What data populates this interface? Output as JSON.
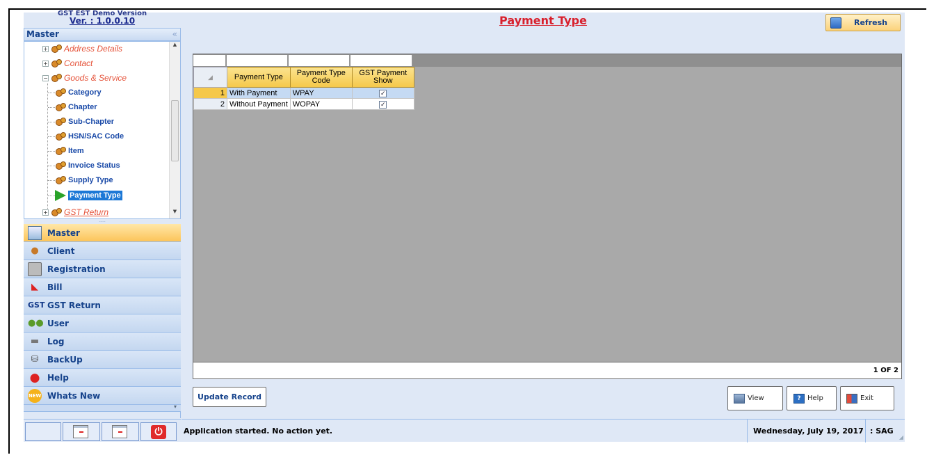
{
  "app": {
    "version_top": "GST EST Demo Version",
    "version": "Ver. : 1.0.0.10"
  },
  "sidebar": {
    "header": "Master",
    "collapse_glyph": "«",
    "tree": {
      "address_details": "Address Details",
      "contact": "Contact",
      "goods_service": "Goods & Service",
      "category": "Category",
      "chapter": "Chapter",
      "sub_chapter": "Sub-Chapter",
      "hsn_sac_code": "HSN/SAC Code",
      "item": "Item",
      "invoice_status": "Invoice Status",
      "supply_type": "Supply Type",
      "payment_type": "Payment Type",
      "gst_return": "GST Return"
    },
    "splitter_glyph": ".....",
    "nav": [
      {
        "label": "Master",
        "icon": "master-icon"
      },
      {
        "label": "Client",
        "icon": "client-icon"
      },
      {
        "label": "Registration",
        "icon": "registration-icon"
      },
      {
        "label": "Bill",
        "icon": "bill-icon"
      },
      {
        "label": "GST Return",
        "icon": "gst-icon",
        "icon_text": "GST"
      },
      {
        "label": "User",
        "icon": "user-icon"
      },
      {
        "label": "Log",
        "icon": "log-icon"
      },
      {
        "label": "BackUp",
        "icon": "backup-icon"
      },
      {
        "label": "Help",
        "icon": "help-icon"
      },
      {
        "label": "Whats New",
        "icon": "new-icon",
        "icon_text": "NEW"
      }
    ]
  },
  "main": {
    "title": "Payment Type",
    "refresh_label": "Refresh",
    "grid": {
      "columns": [
        "Payment Type",
        "Payment Type Code",
        "GST Payment Show"
      ],
      "rows": [
        {
          "num": "1",
          "payment_type": "With Payment",
          "code": "WPAY",
          "show": "✓"
        },
        {
          "num": "2",
          "payment_type": "Without Payment",
          "code": "WOPAY",
          "show": "✓"
        }
      ],
      "pager": "1 OF 2"
    },
    "update_label": "Update Record",
    "view_label": "View",
    "help_label": "Help",
    "exit_label": "Exit"
  },
  "status": {
    "message": "Application started. No action yet.",
    "date": "Wednesday, July 19, 2017",
    "user": ": SAG"
  },
  "colors": {
    "title": "#d81f2c",
    "nav_active": "#fcc45a",
    "selection": "#1c78d6",
    "grid_bg": "#a9a9a9"
  }
}
